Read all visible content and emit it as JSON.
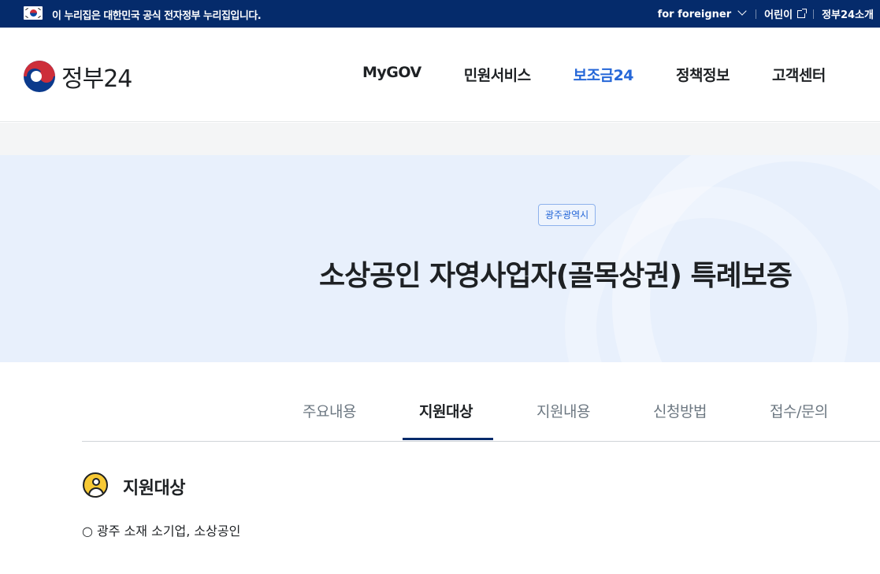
{
  "gov_bar": {
    "notice": "이 누리집은 대한민국 공식 전자정부 누리집입니다.",
    "links": [
      "for foreigner",
      "어린이",
      "정부24소개"
    ]
  },
  "header": {
    "logo_text": "정부24",
    "nav": [
      "MyGOV",
      "민원서비스",
      "보조금24",
      "정책정보",
      "고객센터"
    ],
    "active_nav": "보조금24"
  },
  "hero": {
    "badge": "광주광역시",
    "title": "소상공인 자영사업자(골목상권) 특례보증"
  },
  "tabs": {
    "items": [
      "주요내용",
      "지원대상",
      "지원내용",
      "신청방법",
      "접수/문의"
    ],
    "active": "지원대상"
  },
  "section": {
    "icon": "person-icon",
    "title": "지원대상",
    "content": "○ 광주 소재 소기업, 소상공인"
  },
  "colors": {
    "gov_bar": "#052b6b",
    "accent": "#2567d8",
    "hero_bg": "#e8f0fc"
  }
}
